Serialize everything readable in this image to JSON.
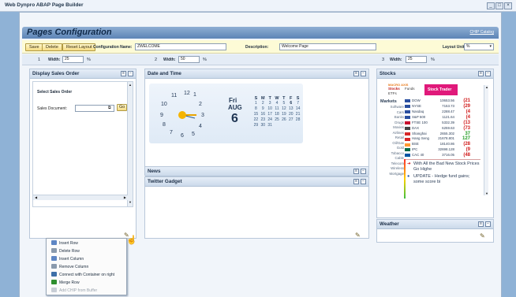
{
  "window": {
    "title": "Web Dynpro ABAP Page Builder",
    "controls": [
      "_",
      "□",
      "×"
    ]
  },
  "header": {
    "title": "Pages Configuration",
    "catalog_link": "CHIP Catalog"
  },
  "config_bar": {
    "buttons": [
      "Save",
      "Delete",
      "Reset Layout"
    ],
    "config_name_label": "Configuration Name:",
    "config_name_value": "ZWELCOME",
    "description_label": "Description:",
    "description_value": "Welcome Page",
    "layout_unit_label": "Layout Unit:",
    "layout_unit_value": "%"
  },
  "columns": [
    {
      "number": "1",
      "width_label": "Width:",
      "width_value": "25",
      "unit": "%"
    },
    {
      "number": "2",
      "width_label": "Width:",
      "width_value": "50",
      "unit": "%"
    },
    {
      "number": "3",
      "width_label": "Width:",
      "width_value": "25",
      "unit": "%"
    }
  ],
  "sales_order": {
    "title": "Display Sales Order",
    "heading": "Select Sales Order",
    "field_label": "Sales Document:",
    "go_label": "Go"
  },
  "date_time": {
    "title": "Date and Time",
    "clock_numbers": [
      "12",
      "1",
      "2",
      "3",
      "4",
      "5",
      "6",
      "7",
      "8",
      "9",
      "10",
      "11"
    ],
    "weekday": "Fri",
    "month": "AUG",
    "day": "6",
    "week_header": [
      "S",
      "M",
      "T",
      "W",
      "T",
      "F",
      "S"
    ],
    "weeks": [
      [
        "",
        "1",
        "2",
        "3",
        "4",
        "5",
        "6",
        "7"
      ],
      [
        "8",
        "9",
        "10",
        "11",
        "12",
        "13",
        "14"
      ],
      [
        "15",
        "16",
        "17",
        "18",
        "19",
        "20",
        "21"
      ],
      [
        "22",
        "23",
        "24",
        "25",
        "26",
        "27",
        "28"
      ],
      [
        "29",
        "30",
        "31",
        "",
        "",
        "",
        ""
      ]
    ]
  },
  "news": {
    "title": "News"
  },
  "twitter": {
    "title": "Twitter Gadget"
  },
  "stocks": {
    "title": "Stocks",
    "tabs": [
      "MACRO AXIS",
      "Stocks",
      "Funds",
      "ETFs"
    ],
    "brand": "Stock Trader",
    "markets_label": "Markets",
    "categories": [
      "Software",
      "Cars",
      "Banks",
      "Drugs",
      "Movies",
      "Airlines",
      "Retail",
      "Oil/Gas",
      "Gold",
      "Tobacco",
      "Cable",
      "Telecom",
      "Wireless",
      "Mortgage"
    ],
    "rows": [
      {
        "name": "DOW",
        "value": "10653.56",
        "change": "(21"
      },
      {
        "name": "NYSE",
        "value": "7153.73",
        "change": "(29"
      },
      {
        "name": "Nasdaq",
        "value": "2288.47",
        "change": "(4"
      },
      {
        "name": "S&P 500",
        "value": "1121.64",
        "change": "(4"
      },
      {
        "name": "FTSE 100",
        "value": "5332.39",
        "change": "(13"
      },
      {
        "name": "DAX",
        "value": "6259.63",
        "change": "(73"
      },
      {
        "name": "Shanghai",
        "value": "2655.302",
        "change": "37"
      },
      {
        "name": "Hang Seng",
        "value": "21678.801",
        "change": "127"
      },
      {
        "name": "BSE",
        "value": "18140.86",
        "change": "(28"
      },
      {
        "name": "IPC",
        "value": "32698.128",
        "change": "(9"
      },
      {
        "name": "CAC 40",
        "value": "3716.05",
        "change": "(48"
      }
    ],
    "news": [
      "With All the Bad New Stock Prices Go Highe",
      "UPDATE - Hedge fund gains; some score bi"
    ]
  },
  "weather": {
    "title": "Weather"
  },
  "context_menu": {
    "items": [
      "Insert Row",
      "Delete Row",
      "Insert Column",
      "Remove Column",
      "Connect with Container on right",
      "Merge Row",
      "Add CHIP from Buffer"
    ]
  }
}
